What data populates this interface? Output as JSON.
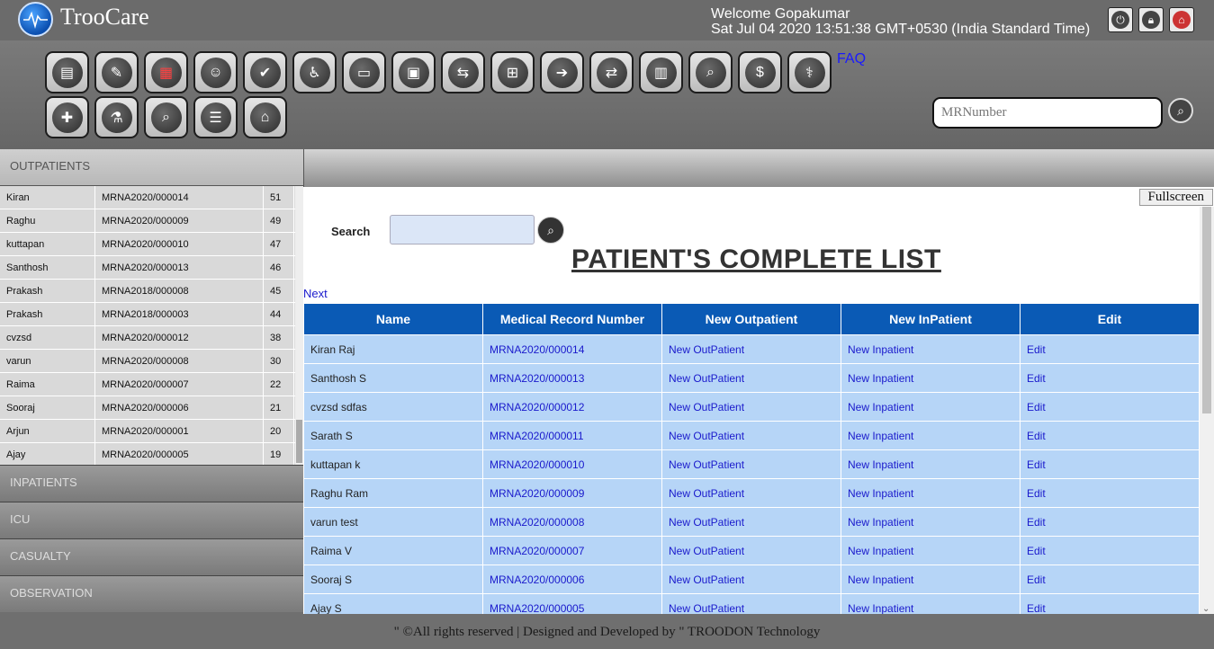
{
  "app": {
    "brand": "TrooCare",
    "welcome_line1": "Welcome Gopakumar",
    "welcome_line2": "Sat Jul 04 2020 13:51:38 GMT+0530 (India Standard Time)",
    "top_icons": [
      "power-icon",
      "lock-icon",
      "home-icon"
    ]
  },
  "toolbar": {
    "row1": [
      {
        "icon": "document-icon",
        "glyph": "▤"
      },
      {
        "icon": "prescription-icon",
        "glyph": "✎"
      },
      {
        "icon": "bill-icon",
        "glyph": "▦",
        "red": true
      },
      {
        "icon": "user-settings-icon",
        "glyph": "☺"
      },
      {
        "icon": "clipboard-check-icon",
        "glyph": "✔"
      },
      {
        "icon": "wheelchair-icon",
        "glyph": "♿"
      },
      {
        "icon": "bed-patient-icon",
        "glyph": "▭"
      },
      {
        "icon": "admission-icon",
        "glyph": "▣"
      },
      {
        "icon": "transfer-icon",
        "glyph": "⇆"
      },
      {
        "icon": "hospital-icon",
        "glyph": "⊞"
      },
      {
        "icon": "discharge-icon",
        "glyph": "➔"
      },
      {
        "icon": "shift-icon",
        "glyph": "⇄"
      },
      {
        "icon": "report-icon",
        "glyph": "▥"
      },
      {
        "icon": "search-icon",
        "glyph": "⌕"
      },
      {
        "icon": "billing-icon",
        "glyph": "$"
      },
      {
        "icon": "doctor-icon",
        "glyph": "⚕"
      }
    ],
    "row2": [
      {
        "icon": "medical-file-icon",
        "glyph": "✚"
      },
      {
        "icon": "lab-flask-icon",
        "glyph": "⚗"
      },
      {
        "icon": "search-icon",
        "glyph": "⌕"
      },
      {
        "icon": "list-icon",
        "glyph": "☰"
      },
      {
        "icon": "ward-icon",
        "glyph": "⌂"
      }
    ],
    "faq": "FAQ",
    "mr_placeholder": "MRNumber"
  },
  "sidebar": {
    "outpatients_label": "OUTPATIENTS",
    "outpatients": [
      {
        "name": "Kiran",
        "mr": "MRNA2020/000014",
        "no": "51"
      },
      {
        "name": "Raghu",
        "mr": "MRNA2020/000009",
        "no": "49"
      },
      {
        "name": "kuttapan",
        "mr": "MRNA2020/000010",
        "no": "47"
      },
      {
        "name": "Santhosh",
        "mr": "MRNA2020/000013",
        "no": "46"
      },
      {
        "name": "Prakash",
        "mr": "MRNA2018/000008",
        "no": "45"
      },
      {
        "name": "Prakash",
        "mr": "MRNA2018/000003",
        "no": "44"
      },
      {
        "name": "cvzsd",
        "mr": "MRNA2020/000012",
        "no": "38"
      },
      {
        "name": "varun",
        "mr": "MRNA2020/000008",
        "no": "30"
      },
      {
        "name": "Raima",
        "mr": "MRNA2020/000007",
        "no": "22"
      },
      {
        "name": "Sooraj",
        "mr": "MRNA2020/000006",
        "no": "21"
      },
      {
        "name": "Arjun",
        "mr": "MRNA2020/000001",
        "no": "20"
      },
      {
        "name": "Ajay",
        "mr": "MRNA2020/000005",
        "no": "19"
      }
    ],
    "sections": [
      "INPATIENTS",
      "ICU",
      "CASUALTY",
      "OBSERVATION"
    ]
  },
  "main": {
    "fullscreen": "Fullscreen",
    "search_label": "Search",
    "title": "PATIENT'S COMPLETE LIST",
    "next": "Next",
    "columns": [
      "Name",
      "Medical Record Number",
      "New Outpatient",
      "New InPatient",
      "Edit"
    ],
    "rows": [
      {
        "name": "Kiran Raj",
        "mr": "MRNA2020/000014",
        "op": "New OutPatient",
        "ip": "New Inpatient",
        "edit": "Edit"
      },
      {
        "name": "Santhosh S",
        "mr": "MRNA2020/000013",
        "op": "New OutPatient",
        "ip": "New Inpatient",
        "edit": "Edit"
      },
      {
        "name": "cvzsd sdfas",
        "mr": "MRNA2020/000012",
        "op": "New OutPatient",
        "ip": "New Inpatient",
        "edit": "Edit"
      },
      {
        "name": "Sarath S",
        "mr": "MRNA2020/000011",
        "op": "New OutPatient",
        "ip": "New Inpatient",
        "edit": "Edit"
      },
      {
        "name": "kuttapan k",
        "mr": "MRNA2020/000010",
        "op": "New OutPatient",
        "ip": "New Inpatient",
        "edit": "Edit"
      },
      {
        "name": "Raghu Ram",
        "mr": "MRNA2020/000009",
        "op": "New OutPatient",
        "ip": "New Inpatient",
        "edit": "Edit"
      },
      {
        "name": "varun test",
        "mr": "MRNA2020/000008",
        "op": "New OutPatient",
        "ip": "New Inpatient",
        "edit": "Edit"
      },
      {
        "name": "Raima V",
        "mr": "MRNA2020/000007",
        "op": "New OutPatient",
        "ip": "New Inpatient",
        "edit": "Edit"
      },
      {
        "name": "Sooraj S",
        "mr": "MRNA2020/000006",
        "op": "New OutPatient",
        "ip": "New Inpatient",
        "edit": "Edit"
      },
      {
        "name": "Ajay S",
        "mr": "MRNA2020/000005",
        "op": "New OutPatient",
        "ip": "New Inpatient",
        "edit": "Edit"
      }
    ]
  },
  "footer": {
    "text": "\" ©All rights reserved | Designed and Developed by \" TROODON Technology"
  },
  "colors": {
    "header_bg": "#6b6b6b",
    "table_header": "#0a5ab5",
    "table_row": "#b6d5f7",
    "link": "#1a1acc"
  }
}
